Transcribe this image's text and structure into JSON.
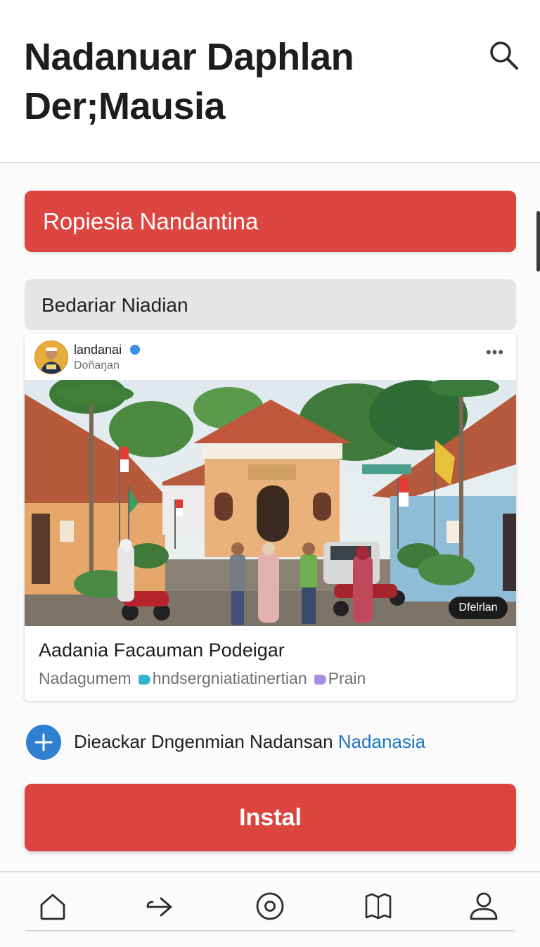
{
  "header": {
    "title_line1": "Nadanuar Daphlan",
    "title_line2": "Der;Mausia",
    "search_icon": "search-icon"
  },
  "banner": {
    "label": "Ropiesia Nandantina",
    "color": "#dd4540"
  },
  "field": {
    "value": "Bedariar Niadian"
  },
  "post": {
    "username": "landanai",
    "subtitle": "Doñaŋan",
    "more_label": "•••",
    "image_badge": "Dfelrlan",
    "title": "Aadania Facauman Podeigar",
    "meta": {
      "author": "Nadagumem",
      "tag1": "hndsergniatiatinertian",
      "tag1_color": "#36b5c8",
      "tag2": "Prain",
      "tag2_color": "#a98de0"
    }
  },
  "add_action": {
    "text": "Dieackar Dngenmian Nadansan",
    "link": "Nadanasia",
    "icon": "plus-icon"
  },
  "install_button": {
    "label": "Instal",
    "color": "#dc443f"
  },
  "nav": [
    {
      "name": "home",
      "icon": "home-icon"
    },
    {
      "name": "share",
      "icon": "arrow-right-icon"
    },
    {
      "name": "record",
      "icon": "target-icon"
    },
    {
      "name": "library",
      "icon": "map-icon"
    },
    {
      "name": "profile",
      "icon": "user-icon"
    }
  ]
}
